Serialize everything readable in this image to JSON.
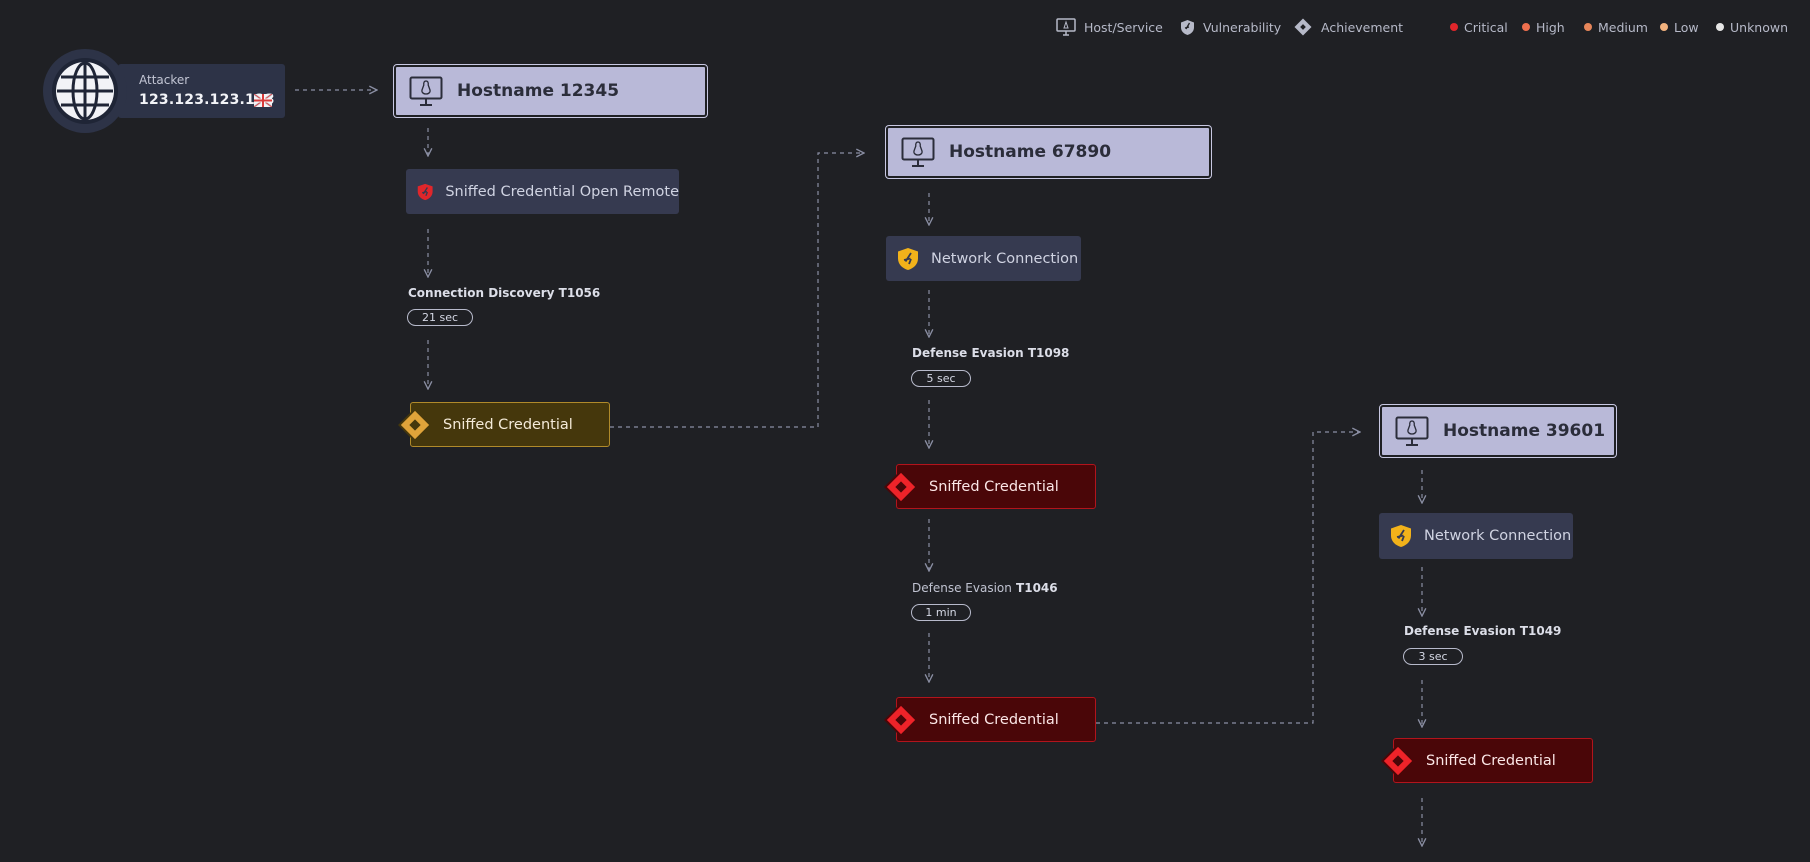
{
  "legend": {
    "types": [
      {
        "label": "Host/Service",
        "icon": "monitor-icon"
      },
      {
        "label": "Vulnerability",
        "icon": "shield-icon"
      },
      {
        "label": "Achievement",
        "icon": "diamond-icon"
      }
    ],
    "severities": [
      {
        "label": "Critical",
        "color": "#e0262b"
      },
      {
        "label": "High",
        "color": "#ee6f4e"
      },
      {
        "label": "Medium",
        "color": "#e7865a"
      },
      {
        "label": "Low",
        "color": "#f2b27e"
      },
      {
        "label": "Unknown",
        "color": "#e6e6e6"
      }
    ]
  },
  "attacker": {
    "label": "Attacker",
    "ip": "123.123.123.123",
    "icon": "globe-icon",
    "flag": "uk-flag-icon"
  },
  "columns": [
    {
      "host": "Hostname 12345",
      "vulnerability": {
        "label": "Sniffed Credential Open Remote",
        "severity": "Critical",
        "color": "#e0262b"
      },
      "technique": {
        "name": "Connection Discovery",
        "id": "T1056",
        "duration": "21 sec"
      },
      "achievements": [
        {
          "label": "Sniffed Credential",
          "style": "gold"
        }
      ]
    },
    {
      "host": "Hostname 67890",
      "vulnerability": {
        "label": "Network Connection",
        "severity": "Medium",
        "color": "#f2b21a"
      },
      "techniques": [
        {
          "name": "Defense Evasion",
          "id": "T1098",
          "duration": "5 sec"
        },
        {
          "name": "Defense Evasion",
          "id": "T1046",
          "duration": "1 min"
        }
      ],
      "achievements": [
        {
          "label": "Sniffed Credential",
          "style": "critical"
        },
        {
          "label": "Sniffed Credential",
          "style": "critical"
        }
      ]
    },
    {
      "host": "Hostname 39601",
      "vulnerability": {
        "label": "Network Connection",
        "severity": "Medium",
        "color": "#f2b21a"
      },
      "technique": {
        "name": "Defense Evasion",
        "id": "T1049",
        "duration": "3 sec"
      },
      "achievements": [
        {
          "label": "Sniffed Credential",
          "style": "critical"
        }
      ]
    }
  ],
  "colors": {
    "background": "#1f2024",
    "host_fill": "#b9b9d8",
    "vuln_fill": "#363a50",
    "edge": "#8a8ea3"
  }
}
